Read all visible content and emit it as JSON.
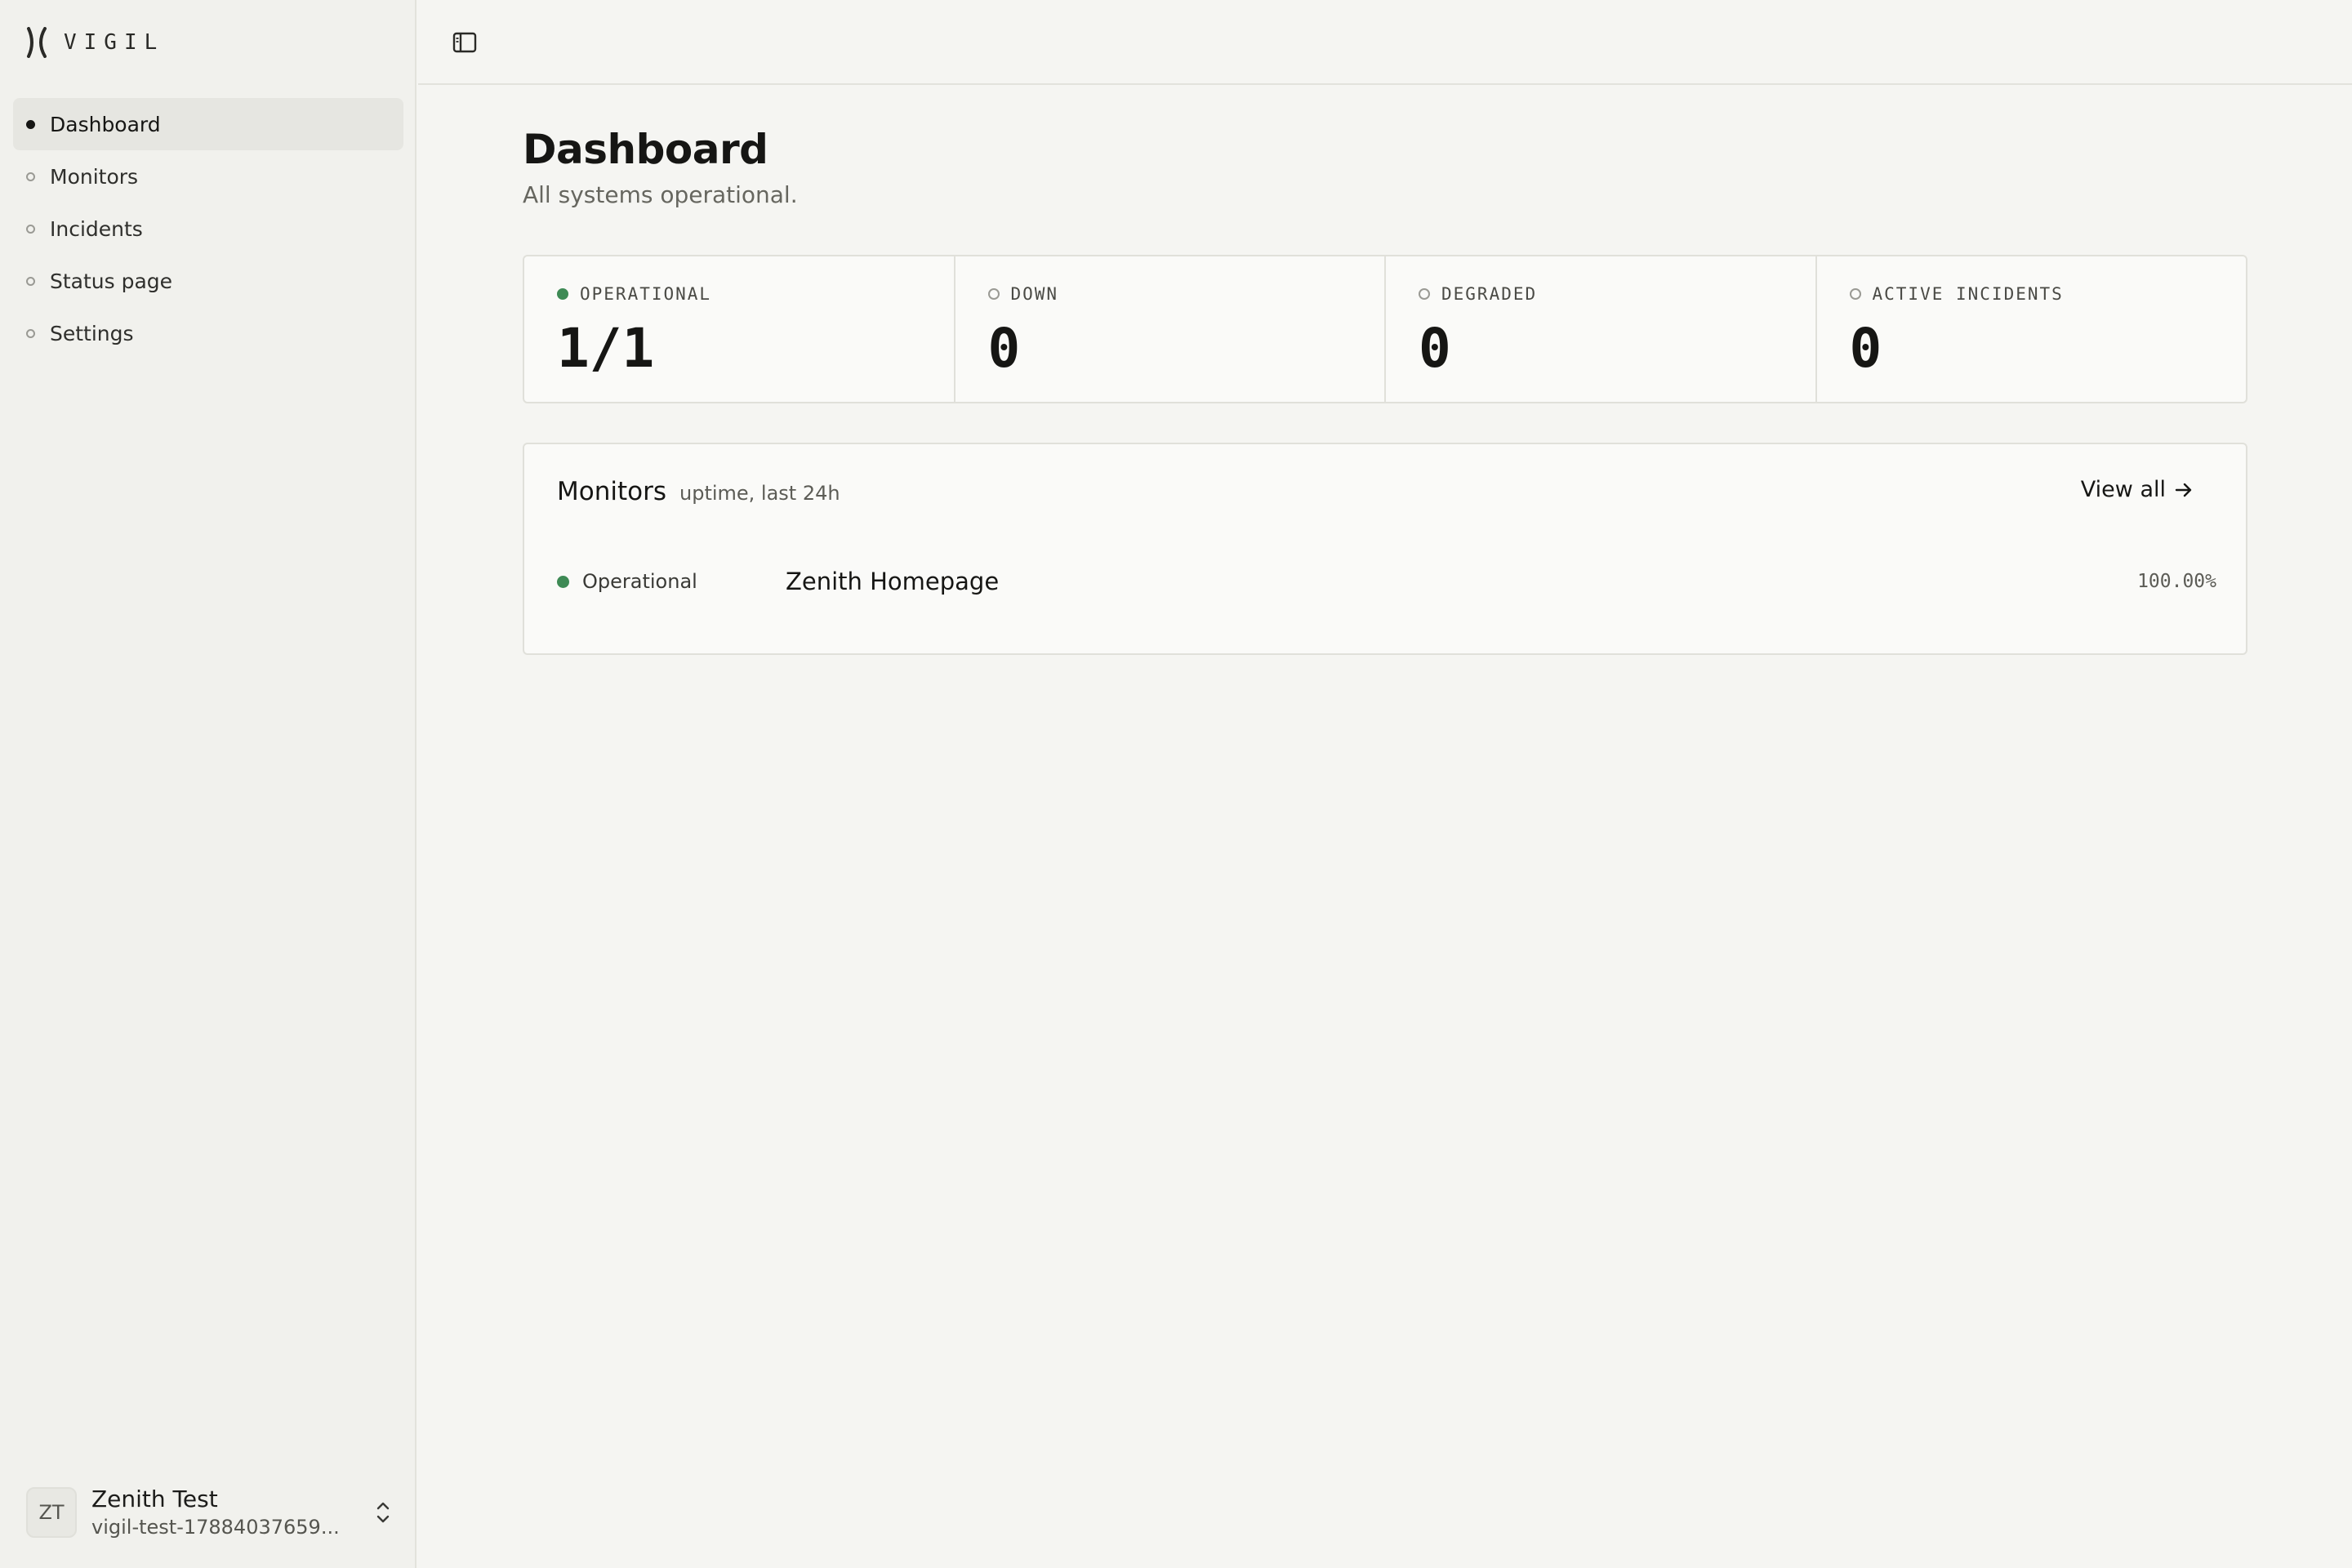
{
  "app": {
    "brand": "VIGIL"
  },
  "sidebar": {
    "items": [
      {
        "label": "Dashboard",
        "active": true
      },
      {
        "label": "Monitors",
        "active": false
      },
      {
        "label": "Incidents",
        "active": false
      },
      {
        "label": "Status page",
        "active": false
      },
      {
        "label": "Settings",
        "active": false
      }
    ]
  },
  "account": {
    "initials": "ZT",
    "name": "Zenith Test",
    "email": "vigil-test-17884037659..."
  },
  "page": {
    "title": "Dashboard",
    "subtitle": "All systems operational."
  },
  "stats": [
    {
      "label": "OPERATIONAL",
      "value": "1/1",
      "status_color": "#3e8a55"
    },
    {
      "label": "DOWN",
      "value": "0",
      "status_color": null
    },
    {
      "label": "DEGRADED",
      "value": "0",
      "status_color": null
    },
    {
      "label": "ACTIVE INCIDENTS",
      "value": "0",
      "status_color": null
    }
  ],
  "monitors": {
    "title": "Monitors",
    "subtitle": "uptime, last 24h",
    "view_all_label": "View all",
    "rows": [
      {
        "status": "Operational",
        "name": "Zenith Homepage",
        "uptime": "100.00%"
      }
    ]
  },
  "colors": {
    "operational": "#3e8a55",
    "background": "#f5f5f2",
    "sidebar": "#f1f1ed"
  }
}
